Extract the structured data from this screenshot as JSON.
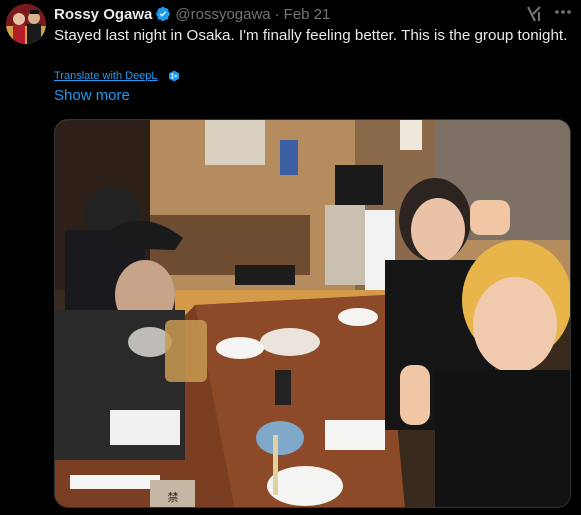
{
  "author": {
    "display_name": "Rossy Ogawa",
    "handle": "@rossyogawa",
    "separator": "·",
    "date": "Feb 21",
    "verified": true
  },
  "tweet": {
    "text": "Stayed last night in Osaka. I'm finally feeling better. This is the group tonight.",
    "translate_label": "Translate with DeepL",
    "show_more_label": "Show more"
  },
  "icons": {
    "verified": "verified-badge-icon",
    "grok": "grok-icon",
    "more": "more-options-icon",
    "deepl": "deepl-icon"
  },
  "colors": {
    "background": "#000000",
    "text": "#e7e9ea",
    "muted": "#71767b",
    "accent": "#1d9bf0"
  },
  "media": {
    "photo_sign_text": "禁"
  }
}
